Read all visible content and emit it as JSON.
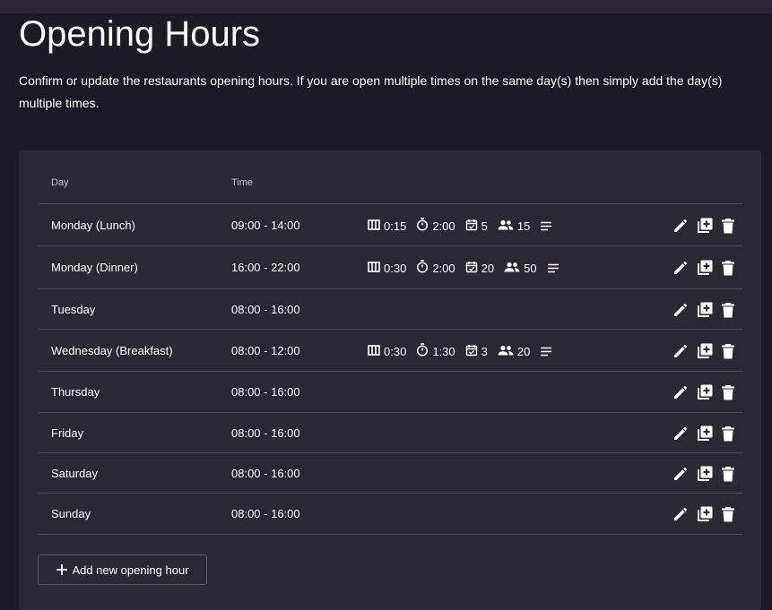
{
  "page": {
    "title": "Opening Hours",
    "description": "Confirm or update the restaurants opening hours. If you are open multiple times on the same day(s) then simply add the day(s) multiple times."
  },
  "table": {
    "headers": {
      "day": "Day",
      "time": "Time"
    },
    "rows": [
      {
        "day": "Monday (Lunch)",
        "time": "09:00 - 14:00",
        "meta": {
          "interval": "0:15",
          "duration": "2:00",
          "bookings": "5",
          "guests": "15"
        }
      },
      {
        "day": "Monday (Dinner)",
        "time": "16:00 - 22:00",
        "meta": {
          "interval": "0:30",
          "duration": "2:00",
          "bookings": "20",
          "guests": "50"
        }
      },
      {
        "day": "Tuesday",
        "time": "08:00 - 16:00"
      },
      {
        "day": "Wednesday (Breakfast)",
        "time": "08:00 - 12:00",
        "meta": {
          "interval": "0:30",
          "duration": "1:30",
          "bookings": "3",
          "guests": "20"
        }
      },
      {
        "day": "Thursday",
        "time": "08:00 - 16:00"
      },
      {
        "day": "Friday",
        "time": "08:00 - 16:00"
      },
      {
        "day": "Saturday",
        "time": "08:00 - 16:00"
      },
      {
        "day": "Sunday",
        "time": "08:00 - 16:00"
      }
    ]
  },
  "add_button": {
    "label": "Add new opening hour"
  },
  "icons": {
    "interval": "columns-icon",
    "duration": "timer-icon",
    "bookings": "event-available-icon",
    "guests": "people-icon",
    "notes": "notes-icon",
    "edit": "pencil-icon",
    "duplicate": "library-add-icon",
    "delete": "trash-icon"
  },
  "colors": {
    "background": "#1c1a22",
    "card": "#2a2830",
    "divider": "#4a4852",
    "text": "#ffffff"
  }
}
